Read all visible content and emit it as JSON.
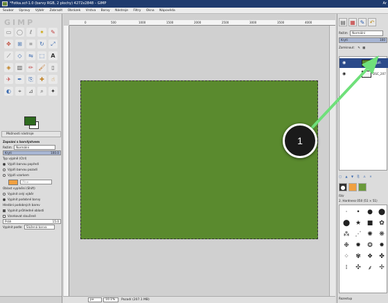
{
  "window": {
    "title": "*Fotka.xcf-1.0 (barvy RGB, 2 plochy) 4272x2848 – GIMP",
    "right_text": "Ar"
  },
  "menubar": {
    "items": [
      "Soubor",
      "Úpravy",
      "Výběr",
      "Zobrazit",
      "Obrázek",
      "Vrstva",
      "Barvy",
      "Nástroje",
      "Filtry",
      "Okna",
      "Nápověda"
    ]
  },
  "toolbox": {
    "logo_text": "GIMP",
    "tools": [
      "rect-select",
      "ellipse-select",
      "free-select",
      "fuzzy-select",
      "paths",
      "move",
      "align",
      "crop",
      "rotate",
      "scale",
      "shear",
      "perspective",
      "flip",
      "cage",
      "text",
      "bucket-fill",
      "blend",
      "pencil",
      "paintbrush",
      "eraser",
      "airbrush",
      "ink",
      "clone",
      "heal",
      "smudge",
      "dodge",
      "color-picker",
      "measure",
      "zoom",
      "foreground-select"
    ],
    "colors": {
      "foreground": "#2e6b1e",
      "background": "#ffffff"
    },
    "options_tab": "Možnosti nástroje",
    "options": {
      "section_title": "Zapsání s barvlýstvem",
      "mode_label": "Režim",
      "mode_value": "Normální",
      "opacity_label": "Krytí",
      "opacity_value": "100.0",
      "fill_label": "Typ výplně (Ctrl)",
      "fill_opt1": "Výplň barvou popředí",
      "fill_opt2": "Výplň barvou pozadí",
      "fill_opt3": "Výplň vzorkem",
      "pattern_name": "Pine",
      "area_label": "Oblast vyplnění (Shift)",
      "area_opt1": "Vyplnit celý výběr",
      "area_opt2": "Vyplnit podobné barvy",
      "similar_label": "Hledání podobných barev",
      "check1": "Vyplnit průhledné oblasti",
      "check2": "Vzorkovat sloučené",
      "threshold_label": "Práh",
      "threshold_value": "15.0",
      "fill_by_label": "Vyplnit podle",
      "fill_by_value": "Složená barva"
    }
  },
  "canvas": {
    "ruler_labels": [
      "0",
      "500",
      "1000",
      "1500",
      "2000",
      "2500",
      "3000",
      "3500",
      "4000"
    ],
    "image_color": "#5a8a2e"
  },
  "statusbar": {
    "units": "px",
    "zoom": "10.1%",
    "info": "Pozadí (207.1 MB)"
  },
  "dock": {
    "mode_label": "Režim",
    "mode_value": "Normální",
    "opacity_label": "Krytí",
    "opacity_value": "100",
    "lock_label": "Zamknout:",
    "layers": [
      {
        "name": "Výplň",
        "selected": true,
        "thumb": "green"
      },
      {
        "name": "DSC_207",
        "selected": false,
        "thumb": "white"
      }
    ],
    "brushes_caption": "2. Hardness 050 (51 × 51)",
    "brushes_filter": "Filtr",
    "spacing_label": "Rozestup",
    "spacing_value": "10"
  },
  "callout": {
    "number": "1",
    "color": "#6fe07a"
  }
}
